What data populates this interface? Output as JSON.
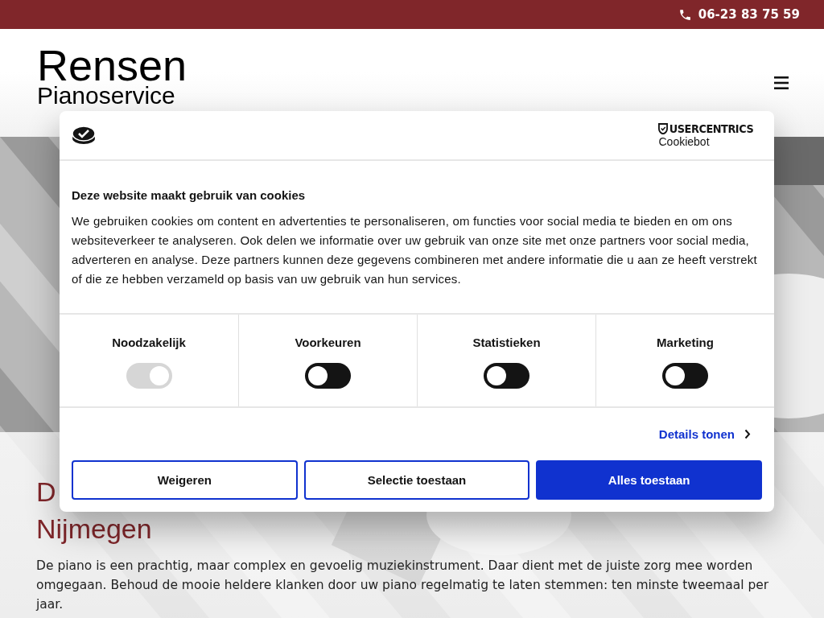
{
  "top_bar": {
    "phone": "06-23 83 75 59"
  },
  "header": {
    "logo_title": "Rensen",
    "logo_subtitle": "Pianoservice"
  },
  "content": {
    "heading_lines": [
      "D",
      "Nijmegen"
    ],
    "paragraph": "De piano is een prachtig, maar complex en gevoelig muziekinstrument. Daar dient met de juiste zorg mee worden omgegaan. Behoud de mooie heldere klanken door uw piano regelmatig te laten stemmen: ten minste tweemaal per jaar."
  },
  "cookie_dialog": {
    "brand": "USERCENTRICS",
    "brand_sub": "Cookiebot",
    "title": "Deze website maakt gebruik van cookies",
    "text": "We gebruiken cookies om content en advertenties te personaliseren, om functies voor social media te bieden en om ons websiteverkeer te analyseren. Ook delen we informatie over uw gebruik van onze site met onze partners voor social media, adverteren en analyse. Deze partners kunnen deze gegevens combineren met andere informatie die u aan ze heeft verstrekt of die ze hebben verzameld op basis van uw gebruik van hun services.",
    "categories": [
      {
        "label": "Noodzakelijk",
        "checked": true,
        "disabled": true
      },
      {
        "label": "Voorkeuren",
        "checked": false,
        "disabled": false
      },
      {
        "label": "Statistieken",
        "checked": false,
        "disabled": false
      },
      {
        "label": "Marketing",
        "checked": false,
        "disabled": false
      }
    ],
    "details_link": "Details tonen",
    "buttons": [
      {
        "label": "Weigeren",
        "kind": "outline"
      },
      {
        "label": "Selectie toestaan",
        "kind": "outline"
      },
      {
        "label": "Alles toestaan",
        "kind": "primary"
      }
    ]
  }
}
